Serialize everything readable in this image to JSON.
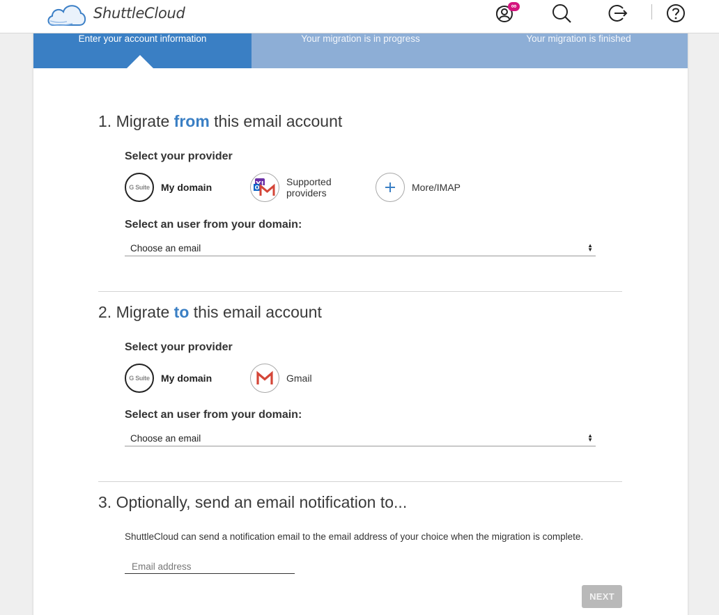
{
  "header": {
    "brand": "ShuttleCloud",
    "icons": [
      "account-infinity-icon",
      "search-icon",
      "logout-icon",
      "help-icon"
    ],
    "badge": "∞"
  },
  "steps": [
    {
      "label": "Enter your account information",
      "state": "active"
    },
    {
      "label": "Your migration is in progress",
      "state": "inactive"
    },
    {
      "label": "Your migration is finished",
      "state": "inactive"
    }
  ],
  "section1": {
    "num": "1. Migrate ",
    "highlight": "from",
    "rest": " this email account",
    "provider_label": "Select your provider",
    "providers": [
      {
        "label": "My domain",
        "icon": "gsuite-icon",
        "icon_text": "G Suite",
        "selected": true
      },
      {
        "label": "Supported providers",
        "icon": "supported-providers-icon",
        "selected": false
      },
      {
        "label": "More/IMAP",
        "icon": "plus-icon",
        "selected": false
      }
    ],
    "user_label": "Select an user from your domain:",
    "select_value": "Choose an email"
  },
  "section2": {
    "num": "2. Migrate ",
    "highlight": "to",
    "rest": " this email account",
    "provider_label": "Select your provider",
    "providers": [
      {
        "label": "My domain",
        "icon": "gsuite-icon",
        "icon_text": "G Suite",
        "selected": true
      },
      {
        "label": "Gmail",
        "icon": "gmail-icon",
        "selected": false
      }
    ],
    "user_label": "Select an user from your domain:",
    "select_value": "Choose an email"
  },
  "section3": {
    "title": "3. Optionally, send an email notification to...",
    "note": "ShuttleCloud can send a notification email to the email address of your choice when the migration is complete.",
    "email_placeholder": "Email address",
    "email_value": ""
  },
  "actions": {
    "next_label": "NEXT"
  },
  "colors": {
    "accent": "#3a7fc4",
    "step_inactive": "#8daed6",
    "button_disabled": "#b9b9b9"
  }
}
